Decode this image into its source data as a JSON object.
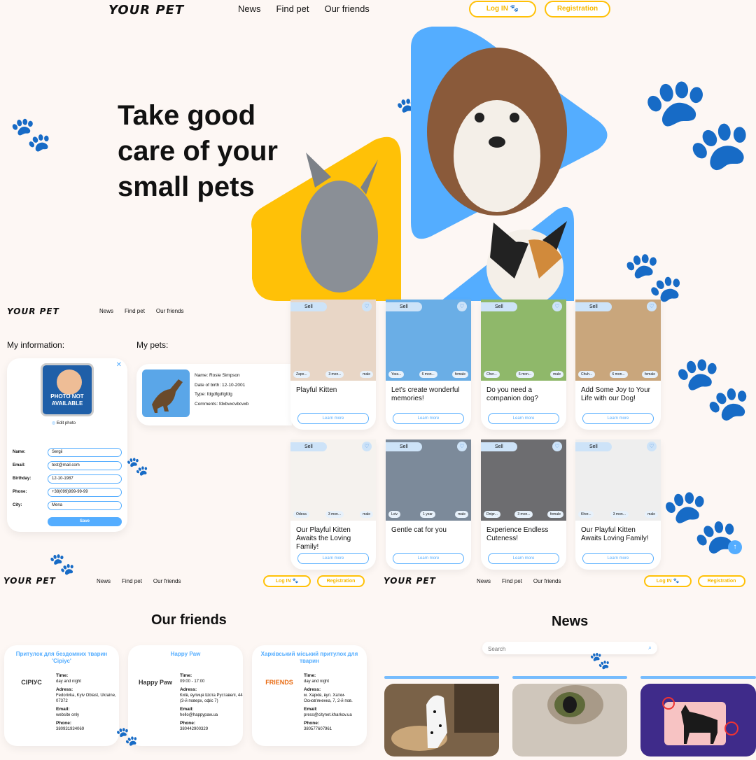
{
  "brand": {
    "logo_text": "YOUR PET"
  },
  "nav": {
    "news": "News",
    "find_pet": "Find pet",
    "our_friends": "Our friends"
  },
  "auth": {
    "login": "Log IN",
    "registration": "Registration"
  },
  "hero": {
    "line1": "Take good",
    "line2": "care of your",
    "line3": "small pets"
  },
  "profile": {
    "my_information": "My information:",
    "my_pets": "My pets:",
    "photo_placeholder": "PHOTO NOT AVAILABLE",
    "edit_photo": "Edit photo",
    "labels": {
      "name": "Name:",
      "email": "Email:",
      "birthday": "Birthday:",
      "phone": "Phone:",
      "city": "City:"
    },
    "values": {
      "name": "Sergii",
      "email": "test@mail.com",
      "birthday": "12-10-1987",
      "phone": "+38(099)999-99-99",
      "city": "Mena"
    },
    "save": "Save",
    "pet": {
      "name": "Name: Rosie Simpson",
      "dob": "Date of birth: 12-10-2001",
      "type": "Type: fdgdfgdfgfdg",
      "comments": "Comments: fdxbvxcvbcvxb"
    }
  },
  "notices": {
    "sell": "Sell",
    "learn_more": "Learn more",
    "cards": [
      {
        "title": "Playful Kitten",
        "loc": "Zapo...",
        "age": "3 mon...",
        "sex": "male",
        "color": "#e8d6c6"
      },
      {
        "title": "Let's create wonderful memories!",
        "loc": "Yara...",
        "age": "6 mon...",
        "sex": "female",
        "color": "#6aaee6"
      },
      {
        "title": "Do you need a companion dog?",
        "loc": "Cher...",
        "age": "6 mon...",
        "sex": "male",
        "color": "#8fb86a"
      },
      {
        "title": "Add Some Joy to Your Life with our Dog!",
        "loc": "Chuh...",
        "age": "6 mon...",
        "sex": "female",
        "color": "#c9a67c"
      },
      {
        "title": "Our Playful Kitten Awaits the Loving Family!",
        "loc": "Odesa",
        "age": "3 mon...",
        "sex": "male",
        "color": "#f5f2ee"
      },
      {
        "title": "Gentle cat for you",
        "loc": "Lviv",
        "age": "1 year",
        "sex": "male",
        "color": "#7c8a9a"
      },
      {
        "title": "Experience Endless Cuteness!",
        "loc": "Dnipr...",
        "age": "3 mon...",
        "sex": "female",
        "color": "#6d6d70"
      },
      {
        "title": "Our Playful Kitten Awaits Loving Family!",
        "loc": "Kher...",
        "age": "3 mon...",
        "sex": "male",
        "color": "#eeeeee"
      }
    ]
  },
  "friends": {
    "heading": "Our friends",
    "labels": {
      "time": "Time:",
      "address": "Adress:",
      "email": "Email:",
      "phone": "Phone:"
    },
    "items": [
      {
        "name": "Притулок для бездомних тварин 'Сіріус'",
        "logo": "СІРІУС",
        "time": "day and night",
        "address": "Fedorivka, Kyiv Oblast, Ukraine, 07372",
        "email": "website only",
        "phone": "380931934069"
      },
      {
        "name": "Happy Paw",
        "logo": "Happy Paw",
        "time": "09:00 - 17:00",
        "address": "Київ, вулиця Шота Руставелі, 44 (3-й поверх, офіс 7)",
        "email": "hello@happypaw.ua",
        "phone": "380442900329"
      },
      {
        "name": "Харківський міський притулок для тварин",
        "logo": "FRIENDS",
        "time": "day and night",
        "address": "м. Харків, вул. Хатки-Основ'яненка, 7, 2-й пов.",
        "email": "press@citynet.kharkov.ua",
        "phone": "380577607961"
      }
    ]
  },
  "news": {
    "heading": "News",
    "search_placeholder": "Search"
  }
}
